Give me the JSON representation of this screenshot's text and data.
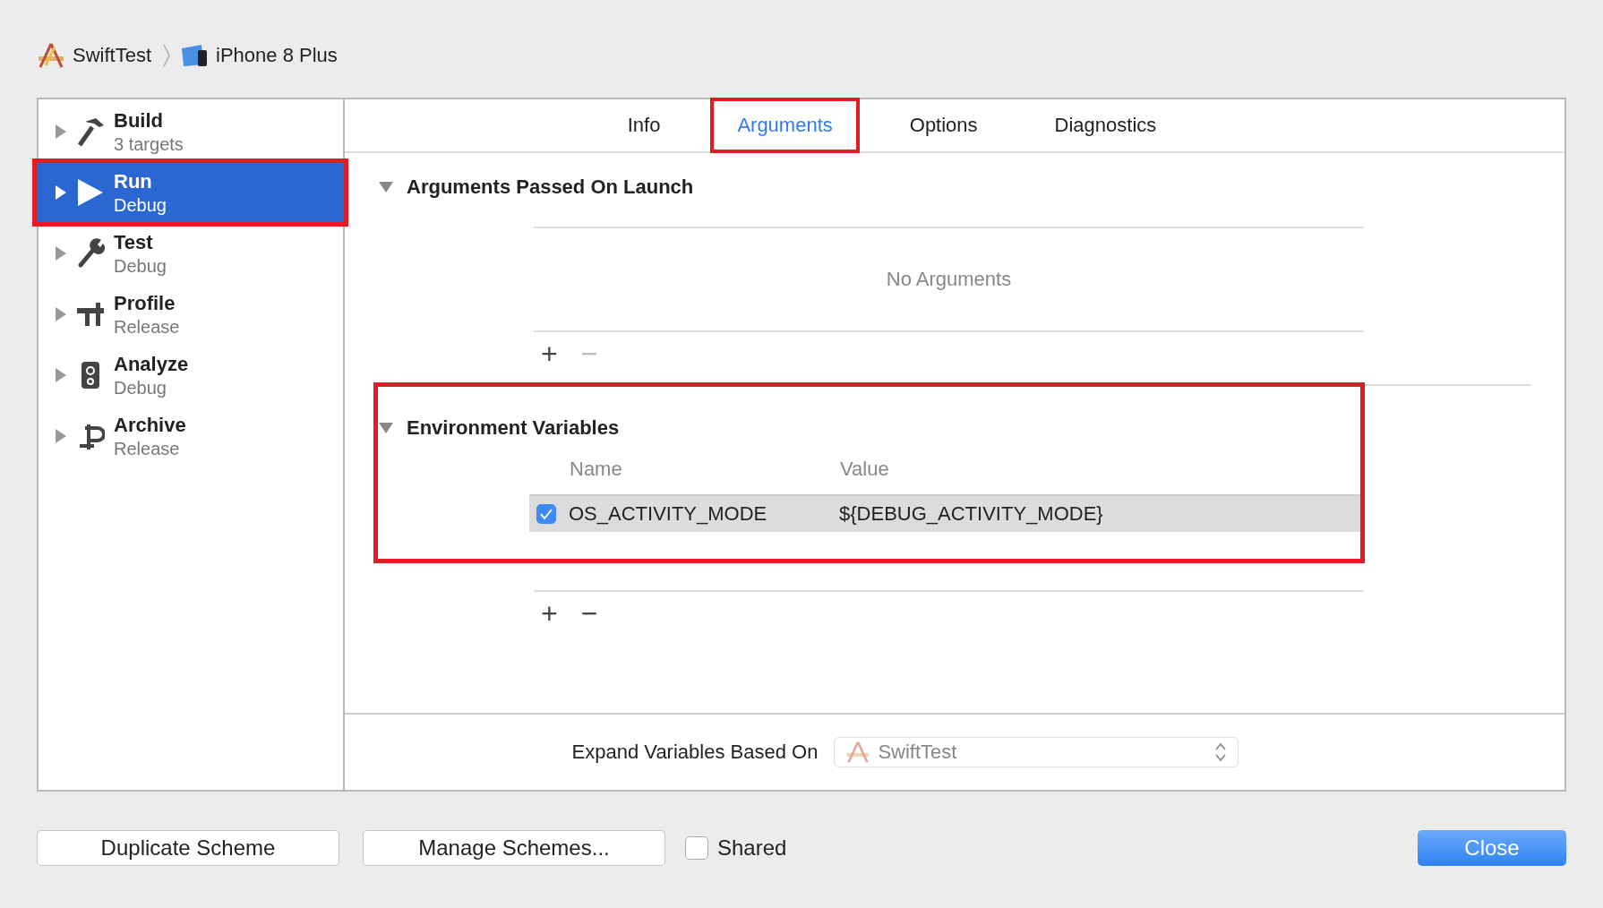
{
  "breadcrumb": [
    {
      "label": "SwiftTest",
      "kind": "project"
    },
    {
      "label": "iPhone 8 Plus",
      "kind": "device"
    }
  ],
  "sidebar": {
    "items": [
      {
        "title": "Build",
        "subtitle": "3 targets",
        "kind": "build",
        "selected": false,
        "annotated": false
      },
      {
        "title": "Run",
        "subtitle": "Debug",
        "kind": "run",
        "selected": true,
        "annotated": true
      },
      {
        "title": "Test",
        "subtitle": "Debug",
        "kind": "test",
        "selected": false,
        "annotated": false
      },
      {
        "title": "Profile",
        "subtitle": "Release",
        "kind": "profile",
        "selected": false,
        "annotated": false
      },
      {
        "title": "Analyze",
        "subtitle": "Debug",
        "kind": "analyze",
        "selected": false,
        "annotated": false
      },
      {
        "title": "Archive",
        "subtitle": "Release",
        "kind": "archive",
        "selected": false,
        "annotated": false
      }
    ]
  },
  "tabs": [
    {
      "label": "Info",
      "selected": false,
      "annotated": false
    },
    {
      "label": "Arguments",
      "selected": true,
      "annotated": true
    },
    {
      "label": "Options",
      "selected": false,
      "annotated": false
    },
    {
      "label": "Diagnostics",
      "selected": false,
      "annotated": false
    }
  ],
  "arguments": {
    "title": "Arguments Passed On Launch",
    "expanded": true,
    "empty_text": "No Arguments",
    "add": "+",
    "remove": "−",
    "remove_disabled": true
  },
  "environment": {
    "title": "Environment Variables",
    "expanded": true,
    "annotated": true,
    "columns": [
      "Name",
      "Value"
    ],
    "rows": [
      {
        "name": "OS_ACTIVITY_MODE",
        "value": "${DEBUG_ACTIVITY_MODE}",
        "checked": true
      }
    ],
    "add": "+",
    "remove": "−",
    "remove_disabled": false
  },
  "expand": {
    "label": "Expand Variables Based On",
    "value": "SwiftTest",
    "disabled": true
  },
  "footer": {
    "buttons": [
      "Duplicate Scheme",
      "Manage Schemes..."
    ],
    "shared": {
      "label": "Shared",
      "checked": false
    },
    "close": "Close"
  }
}
